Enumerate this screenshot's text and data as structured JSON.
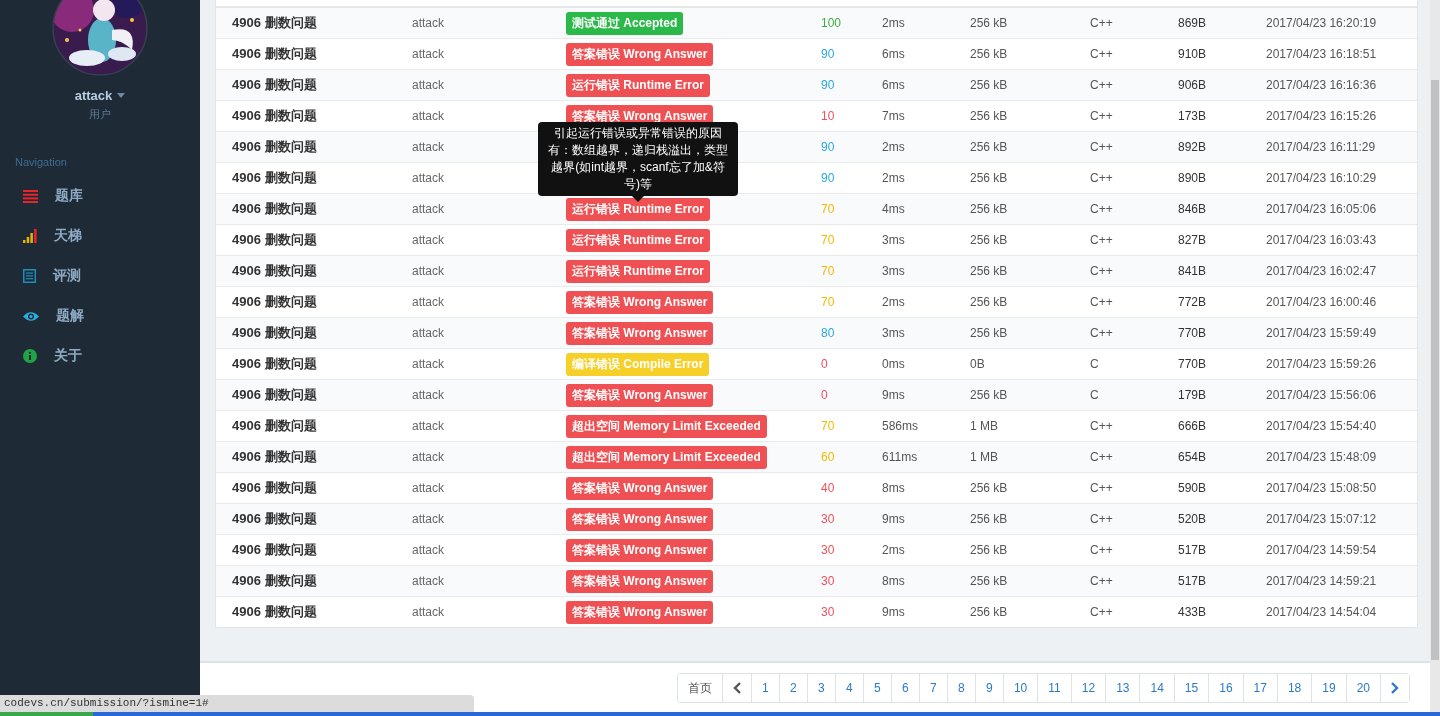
{
  "sidebar": {
    "user": {
      "name": "attack",
      "role": "用户"
    },
    "nav_heading": "Navigation",
    "items": [
      {
        "label": "题库"
      },
      {
        "label": "天梯"
      },
      {
        "label": "评测"
      },
      {
        "label": "题解"
      },
      {
        "label": "关于"
      }
    ]
  },
  "table": {
    "rows": [
      {
        "problem": "4906 删数问题",
        "user": "attack",
        "status": {
          "kind": "accepted",
          "label": "测试通过 Accepted"
        },
        "score": "100",
        "color": "#3cb043",
        "time": "2ms",
        "memory": "256 kB",
        "language": "C++",
        "length": "869B",
        "submitted": "2017/04/23 16:20:19"
      },
      {
        "problem": "4906 删数问题",
        "user": "attack",
        "status": {
          "kind": "error",
          "label": "答案错误 Wrong Answer"
        },
        "score": "90",
        "color": "#29a8e0",
        "time": "6ms",
        "memory": "256 kB",
        "language": "C++",
        "length": "910B",
        "submitted": "2017/04/23 16:18:51"
      },
      {
        "problem": "4906 删数问题",
        "user": "attack",
        "status": {
          "kind": "error",
          "label": "运行错误 Runtime Error"
        },
        "score": "90",
        "color": "#29a8e0",
        "time": "6ms",
        "memory": "256 kB",
        "language": "C++",
        "length": "906B",
        "submitted": "2017/04/23 16:16:36"
      },
      {
        "problem": "4906 删数问题",
        "user": "attack",
        "status": {
          "kind": "error",
          "label": "答案错误 Wrong Answer"
        },
        "score": "10",
        "color": "#f0505a",
        "time": "7ms",
        "memory": "256 kB",
        "language": "C++",
        "length": "173B",
        "submitted": "2017/04/23 16:15:26"
      },
      {
        "problem": "4906 删数问题",
        "user": "attack",
        "score": "90",
        "color": "#29a8e0",
        "time": "2ms",
        "memory": "256 kB",
        "language": "C++",
        "length": "892B",
        "submitted": "2017/04/23 16:11:29"
      },
      {
        "problem": "4906 删数问题",
        "user": "attack",
        "score": "90",
        "color": "#29a8e0",
        "time": "2ms",
        "memory": "256 kB",
        "language": "C++",
        "length": "890B",
        "submitted": "2017/04/23 16:10:29"
      },
      {
        "problem": "4906 删数问题",
        "user": "attack",
        "status": {
          "kind": "error",
          "label": "运行错误 Runtime Error"
        },
        "score": "70",
        "color": "#f5b800",
        "time": "4ms",
        "memory": "256 kB",
        "language": "C++",
        "length": "846B",
        "submitted": "2017/04/23 16:05:06"
      },
      {
        "problem": "4906 删数问题",
        "user": "attack",
        "status": {
          "kind": "error",
          "label": "运行错误 Runtime Error"
        },
        "score": "70",
        "color": "#f5b800",
        "time": "3ms",
        "memory": "256 kB",
        "language": "C++",
        "length": "827B",
        "submitted": "2017/04/23 16:03:43"
      },
      {
        "problem": "4906 删数问题",
        "user": "attack",
        "status": {
          "kind": "error",
          "label": "运行错误 Runtime Error"
        },
        "score": "70",
        "color": "#f5b800",
        "time": "3ms",
        "memory": "256 kB",
        "language": "C++",
        "length": "841B",
        "submitted": "2017/04/23 16:02:47"
      },
      {
        "problem": "4906 删数问题",
        "user": "attack",
        "status": {
          "kind": "error",
          "label": "答案错误 Wrong Answer"
        },
        "score": "70",
        "color": "#f5b800",
        "time": "2ms",
        "memory": "256 kB",
        "language": "C++",
        "length": "772B",
        "submitted": "2017/04/23 16:00:46"
      },
      {
        "problem": "4906 删数问题",
        "user": "attack",
        "status": {
          "kind": "error",
          "label": "答案错误 Wrong Answer"
        },
        "score": "80",
        "color": "#29a8e0",
        "time": "3ms",
        "memory": "256 kB",
        "language": "C++",
        "length": "770B",
        "submitted": "2017/04/23 15:59:49"
      },
      {
        "problem": "4906 删数问题",
        "user": "attack",
        "status": {
          "kind": "compile",
          "label": "编译错误 Compile Error"
        },
        "score": "0",
        "color": "#f0505a",
        "time": "0ms",
        "memory": "0B",
        "language": "C",
        "length": "770B",
        "submitted": "2017/04/23 15:59:26"
      },
      {
        "problem": "4906 删数问题",
        "user": "attack",
        "status": {
          "kind": "error",
          "label": "答案错误 Wrong Answer"
        },
        "score": "0",
        "color": "#f0505a",
        "time": "9ms",
        "memory": "256 kB",
        "language": "C",
        "length": "179B",
        "submitted": "2017/04/23 15:56:06"
      },
      {
        "problem": "4906 删数问题",
        "user": "attack",
        "status": {
          "kind": "error",
          "label": "超出空间 Memory Limit Exceeded"
        },
        "score": "70",
        "color": "#f5b800",
        "time": "586ms",
        "memory": "1 MB",
        "language": "C++",
        "length": "666B",
        "submitted": "2017/04/23 15:54:40"
      },
      {
        "problem": "4906 删数问题",
        "user": "attack",
        "status": {
          "kind": "error",
          "label": "超出空间 Memory Limit Exceeded"
        },
        "score": "60",
        "color": "#f5b800",
        "time": "611ms",
        "memory": "1 MB",
        "language": "C++",
        "length": "654B",
        "submitted": "2017/04/23 15:48:09"
      },
      {
        "problem": "4906 删数问题",
        "user": "attack",
        "status": {
          "kind": "error",
          "label": "答案错误 Wrong Answer"
        },
        "score": "40",
        "color": "#f0505a",
        "time": "8ms",
        "memory": "256 kB",
        "language": "C++",
        "length": "590B",
        "submitted": "2017/04/23 15:08:50"
      },
      {
        "problem": "4906 删数问题",
        "user": "attack",
        "status": {
          "kind": "error",
          "label": "答案错误 Wrong Answer"
        },
        "score": "30",
        "color": "#f0505a",
        "time": "9ms",
        "memory": "256 kB",
        "language": "C++",
        "length": "520B",
        "submitted": "2017/04/23 15:07:12"
      },
      {
        "problem": "4906 删数问题",
        "user": "attack",
        "status": {
          "kind": "error",
          "label": "答案错误 Wrong Answer"
        },
        "score": "30",
        "color": "#f0505a",
        "time": "2ms",
        "memory": "256 kB",
        "language": "C++",
        "length": "517B",
        "submitted": "2017/04/23 14:59:54"
      },
      {
        "problem": "4906 删数问题",
        "user": "attack",
        "status": {
          "kind": "error",
          "label": "答案错误 Wrong Answer"
        },
        "score": "30",
        "color": "#f0505a",
        "time": "8ms",
        "memory": "256 kB",
        "language": "C++",
        "length": "517B",
        "submitted": "2017/04/23 14:59:21"
      },
      {
        "problem": "4906 删数问题",
        "user": "attack",
        "status": {
          "kind": "error",
          "label": "答案错误 Wrong Answer"
        },
        "score": "30",
        "color": "#f0505a",
        "time": "9ms",
        "memory": "256 kB",
        "language": "C++",
        "length": "433B",
        "submitted": "2017/04/23 14:54:04"
      }
    ]
  },
  "tooltip": "引起运行错误或异常错误的原因有：数组越界，递归栈溢出，类型越界(如int越界，scanf忘了加&符号)等",
  "pagination": {
    "first": "首页",
    "pages": [
      "1",
      "2",
      "3",
      "4",
      "5",
      "6",
      "7",
      "8",
      "9",
      "10",
      "11",
      "12",
      "13",
      "14",
      "15",
      "16",
      "17",
      "18",
      "19",
      "20"
    ]
  },
  "status_url": "codevs.cn/submission/?ismine=1#"
}
